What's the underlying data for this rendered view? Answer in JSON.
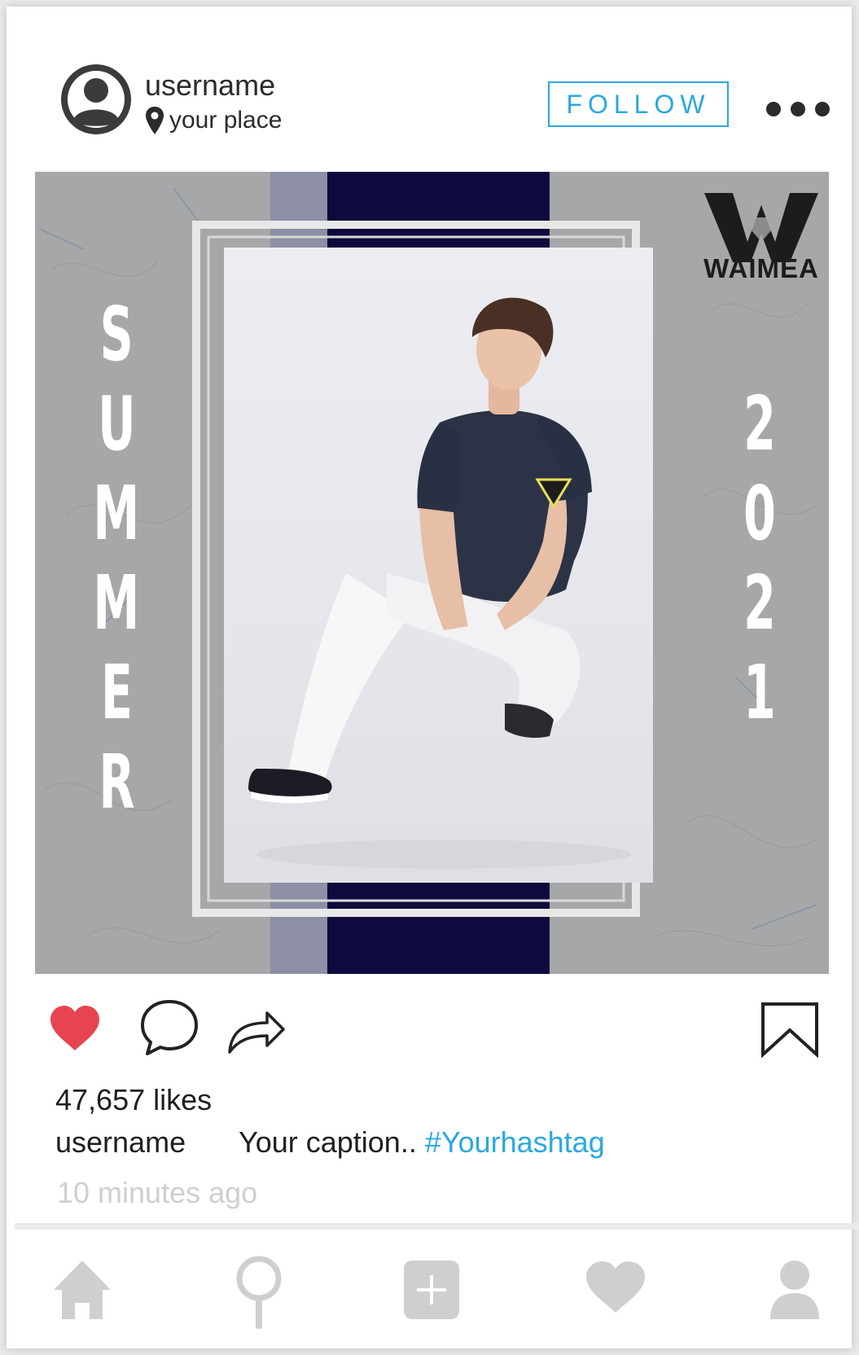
{
  "header": {
    "username": "username",
    "location": "your place",
    "follow_label": "FOLLOW"
  },
  "post": {
    "left_text_letters": [
      "S",
      "U",
      "M",
      "M",
      "E",
      "R"
    ],
    "right_text_digits": [
      "2",
      "0",
      "2",
      "1"
    ],
    "brand_name": "WAIMEA"
  },
  "engagement": {
    "likes": "47,657 likes",
    "caption_username": "username",
    "caption_text": "Your caption.. ",
    "hashtag": "#Yourhashtag",
    "timestamp": "10 minutes ago"
  },
  "icons": {
    "like": "heart-icon",
    "comment": "comment-icon",
    "share": "share-arrow-icon",
    "save": "bookmark-icon",
    "nav": [
      "home-icon",
      "search-icon",
      "add-post-icon",
      "activity-heart-icon",
      "profile-icon"
    ]
  },
  "colors": {
    "accent": "#29a8e0",
    "like_red": "#e8444f",
    "nav_gray": "#cfcfcf",
    "stripe_navy": "#0e0a3d"
  }
}
